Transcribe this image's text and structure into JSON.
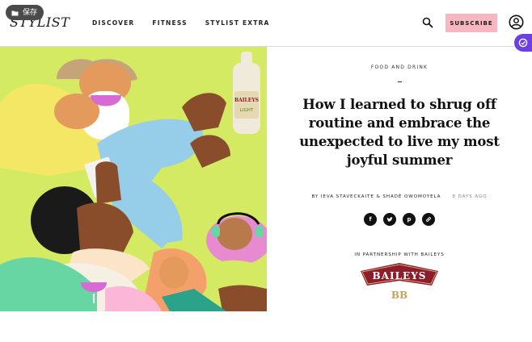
{
  "overlay": {
    "save_label": "保存"
  },
  "header": {
    "logo": "STYLIST",
    "nav": [
      "DISCOVER",
      "FITNESS",
      "STYLIST EXTRA"
    ],
    "subscribe_label": "SUBSCRIBE"
  },
  "hero": {
    "bottle_label_brand": "BAILEYS",
    "bottle_label_variant": "LIGHT"
  },
  "article": {
    "category": "FOOD AND DRINK",
    "title": "How I learned to shrug off routine and embrace the unexpected to live my most joyful summer",
    "byline": "BY IEVA STAVECKAITE & SHADÉ OWOMOYELA",
    "time_ago": "8 DAYS AGO",
    "share_icons": [
      "facebook-icon",
      "twitter-icon",
      "pinterest-icon",
      "link-icon"
    ],
    "partnership": "IN PARTNERSHIP WITH BAILEYS",
    "partner_logo_text": "BAILEYS"
  },
  "colors": {
    "subscribe_bg": "#f7b7c1",
    "hero_bg": "#d3ea62",
    "extension_badge": "#6d3ee0",
    "partner_logo_red": "#8c1d2a"
  }
}
